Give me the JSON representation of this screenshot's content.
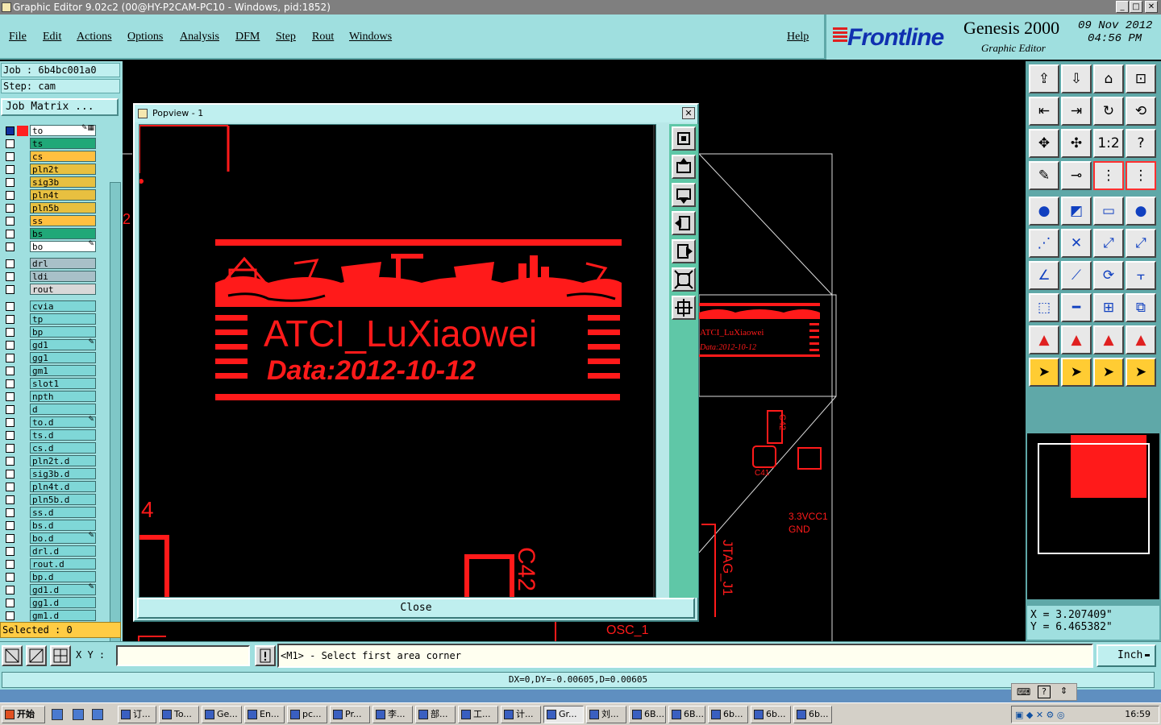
{
  "window": {
    "title": "Graphic Editor 9.02c2 (00@HY-P2CAM-PC10 - Windows, pid:1852)",
    "min": "_",
    "max": "□",
    "close": "✕"
  },
  "menu": [
    "File",
    "Edit",
    "Actions",
    "Options",
    "Analysis",
    "DFM",
    "Step",
    "Rout",
    "Windows",
    "Help"
  ],
  "brand": {
    "logo": "Frontline",
    "product": "Genesis 2000",
    "subtitle": "Graphic Editor",
    "date": "09 Nov 2012",
    "time": "04:56 PM"
  },
  "left": {
    "job": "Job : 6b4bc001a0",
    "step": "Step: cam",
    "job_matrix": "Job Matrix ...",
    "selected": "Selected : 0",
    "layers": [
      {
        "name": "to",
        "color": "#ffffff",
        "active": true,
        "flag": "✎▦"
      },
      {
        "name": "ts",
        "color": "#20a878"
      },
      {
        "name": "cs",
        "color": "#ffc040"
      },
      {
        "name": "pln2t",
        "color": "#e8c040"
      },
      {
        "name": "sig3b",
        "color": "#e8c040"
      },
      {
        "name": "pln4t",
        "color": "#e8c040"
      },
      {
        "name": "pln5b",
        "color": "#e8c040"
      },
      {
        "name": "ss",
        "color": "#ffc040"
      },
      {
        "name": "bs",
        "color": "#20a878"
      },
      {
        "name": "bo",
        "color": "#ffffff",
        "flag": "✎"
      },
      {
        "name": "drl",
        "color": "#a8c0c8",
        "gap": true
      },
      {
        "name": "ldi",
        "color": "#a8c0c8"
      },
      {
        "name": "rout",
        "color": "#d8d8d8"
      },
      {
        "name": "cvia",
        "color": "#7fd7d7",
        "gap": true
      },
      {
        "name": "tp",
        "color": "#7fd7d7"
      },
      {
        "name": "bp",
        "color": "#7fd7d7"
      },
      {
        "name": "gd1",
        "color": "#7fd7d7",
        "flag": "✎"
      },
      {
        "name": "gg1",
        "color": "#7fd7d7"
      },
      {
        "name": "gm1",
        "color": "#7fd7d7"
      },
      {
        "name": "slot1",
        "color": "#7fd7d7"
      },
      {
        "name": "npth",
        "color": "#7fd7d7"
      },
      {
        "name": "d",
        "color": "#7fd7d7"
      },
      {
        "name": "to.d",
        "color": "#7fd7d7",
        "flag": "✎"
      },
      {
        "name": "ts.d",
        "color": "#7fd7d7"
      },
      {
        "name": "cs.d",
        "color": "#7fd7d7"
      },
      {
        "name": "pln2t.d",
        "color": "#7fd7d7"
      },
      {
        "name": "sig3b.d",
        "color": "#7fd7d7"
      },
      {
        "name": "pln4t.d",
        "color": "#7fd7d7"
      },
      {
        "name": "pln5b.d",
        "color": "#7fd7d7"
      },
      {
        "name": "ss.d",
        "color": "#7fd7d7"
      },
      {
        "name": "bs.d",
        "color": "#7fd7d7"
      },
      {
        "name": "bo.d",
        "color": "#7fd7d7",
        "flag": "✎"
      },
      {
        "name": "drl.d",
        "color": "#7fd7d7"
      },
      {
        "name": "rout.d",
        "color": "#7fd7d7"
      },
      {
        "name": "bp.d",
        "color": "#7fd7d7"
      },
      {
        "name": "gd1.d",
        "color": "#7fd7d7",
        "flag": "✎"
      },
      {
        "name": "gg1.d",
        "color": "#7fd7d7"
      },
      {
        "name": "gm1.d",
        "color": "#7fd7d7"
      }
    ]
  },
  "popview": {
    "title": "Popview - 1",
    "logo_text": "ATCI_LuXiaowei",
    "date_text": "Data:2012-10-12",
    "label_4": "4",
    "label_c42": "C42",
    "close_label": "Close"
  },
  "canvas": {
    "labels": {
      "num2": "2",
      "osc": "OSC_1",
      "jtag": "JTAG_J1",
      "vcc": "3.3VCC1",
      "gnd": "GND",
      "small_logo": "ATCI_LuXiaowei",
      "small_date": "Data:2012-10-12",
      "c42": "C42",
      "c41": "C41"
    }
  },
  "coords": {
    "x": "X = 3.207409\"",
    "y": "Y = 6.465382\""
  },
  "command": {
    "xy_label": "X Y :",
    "xy_value": "",
    "prompt": "<M1> - Select first area corner",
    "unit": "Inch",
    "status": "DX=0,DY=-0.00605,D=0.00605"
  },
  "taskbar": {
    "start": "开始",
    "tasks": [
      "订...",
      "To...",
      "Ge...",
      "En...",
      "pc...",
      "Pr...",
      "李...",
      "部...",
      "工...",
      "计...",
      "Gr...",
      "刘...",
      "6B...",
      "6B...",
      "6b...",
      "6b...",
      "6b..."
    ],
    "clock": "16:59"
  }
}
